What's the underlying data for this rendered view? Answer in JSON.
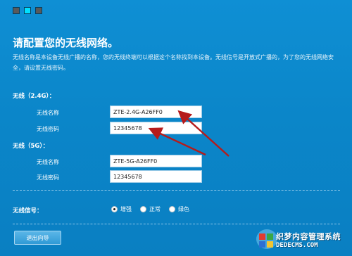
{
  "colors": {
    "background": "#0b86c9",
    "dot_1": "#5a5a5a",
    "dot_2": "#00e0ff",
    "dot_3": "#5a5a5a",
    "arrow": "#b51b1b"
  },
  "header": {
    "title": "请配置您的无线网络。",
    "description": "无线名称是本设备无线广播的名称，您的无线终端可以根据这个名称找到本设备。无线信号是开放式广播的，为了您的无线网络安全，请设置无线密码。"
  },
  "band_24g": {
    "label": "无线（2.4G）：",
    "ssid_label": "无线名称",
    "ssid_value": "ZTE-2.4G-A26FF0",
    "password_label": "无线密码",
    "password_value": "12345678"
  },
  "band_5g": {
    "label": "无线（5G）：",
    "ssid_label": "无线名称",
    "ssid_value": "ZTE-5G-A26FF0",
    "password_label": "无线密码",
    "password_value": "12345678"
  },
  "signal": {
    "label": "无线信号：",
    "options": [
      {
        "label": "增强",
        "checked": true
      },
      {
        "label": "正常",
        "checked": false
      },
      {
        "label": "绿色",
        "checked": false
      }
    ]
  },
  "footer": {
    "exit_label": "退出向导"
  },
  "watermark": {
    "line1": "织梦内容管理系统",
    "line2": "DEDECMS.COM"
  }
}
